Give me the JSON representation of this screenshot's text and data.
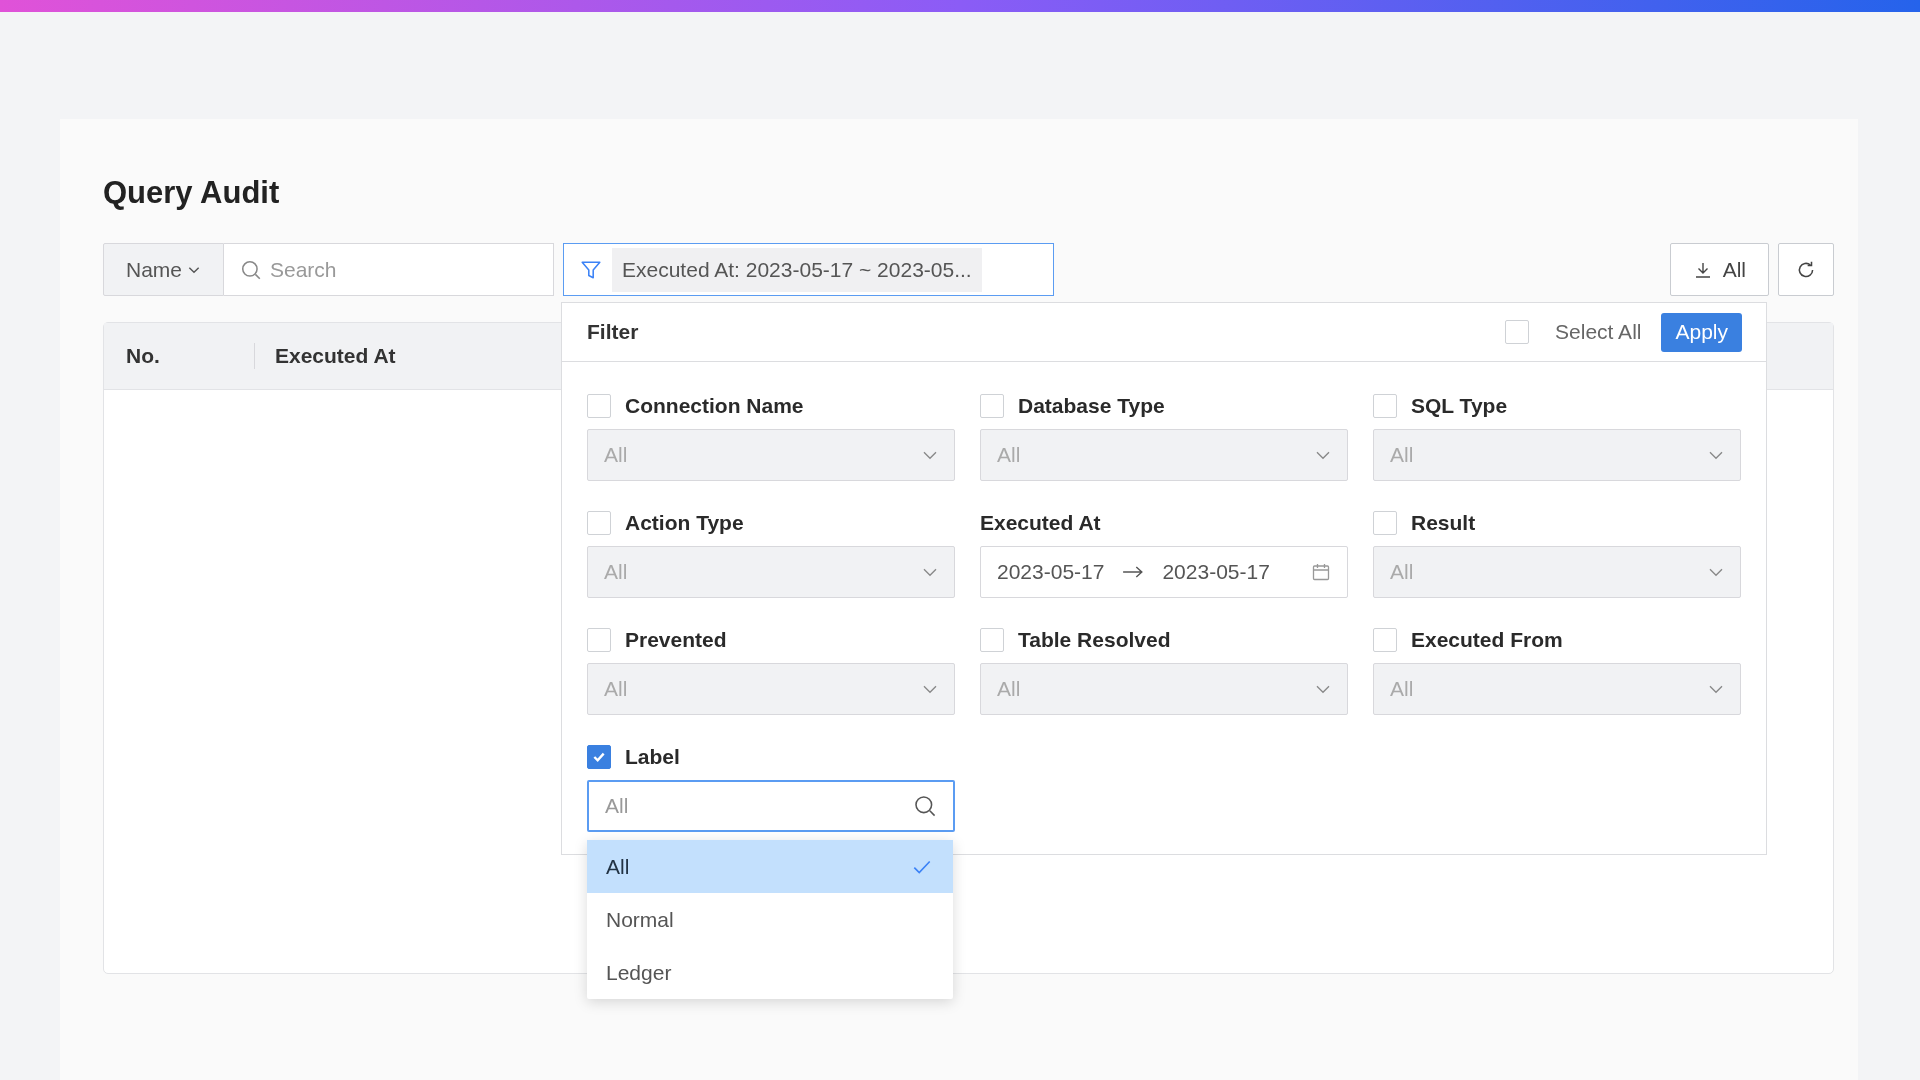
{
  "page": {
    "title": "Query Audit"
  },
  "toolbar": {
    "search_scope": "Name",
    "search": {
      "placeholder": "Search"
    },
    "filter_tag": "Executed At: 2023-05-17 ~ 2023-05...",
    "export_button": "All"
  },
  "table": {
    "columns": [
      "No.",
      "Executed At"
    ]
  },
  "filter_panel": {
    "title": "Filter",
    "select_all": {
      "label": "Select All",
      "checked": false
    },
    "apply_button": "Apply",
    "fields": [
      {
        "kind": "select",
        "label": "Connection Name",
        "checked": false,
        "placeholder": "All"
      },
      {
        "kind": "select",
        "label": "Database Type",
        "checked": false,
        "placeholder": "All"
      },
      {
        "kind": "select",
        "label": "SQL Type",
        "checked": false,
        "placeholder": "All"
      },
      {
        "kind": "select",
        "label": "Action Type",
        "checked": false,
        "placeholder": "All"
      },
      {
        "kind": "date_range",
        "label": "Executed At",
        "start": "2023-05-17",
        "end": "2023-05-17"
      },
      {
        "kind": "select",
        "label": "Result",
        "checked": false,
        "placeholder": "All"
      },
      {
        "kind": "select",
        "label": "Prevented",
        "checked": false,
        "placeholder": "All"
      },
      {
        "kind": "select",
        "label": "Table Resolved",
        "checked": false,
        "placeholder": "All"
      },
      {
        "kind": "select",
        "label": "Executed From",
        "checked": false,
        "placeholder": "All"
      },
      {
        "kind": "search",
        "label": "Label",
        "checked": true,
        "placeholder": "All",
        "expanded": true,
        "options": [
          {
            "label": "All",
            "selected": true
          },
          {
            "label": "Normal",
            "selected": false
          },
          {
            "label": "Ledger",
            "selected": false
          }
        ]
      }
    ]
  }
}
